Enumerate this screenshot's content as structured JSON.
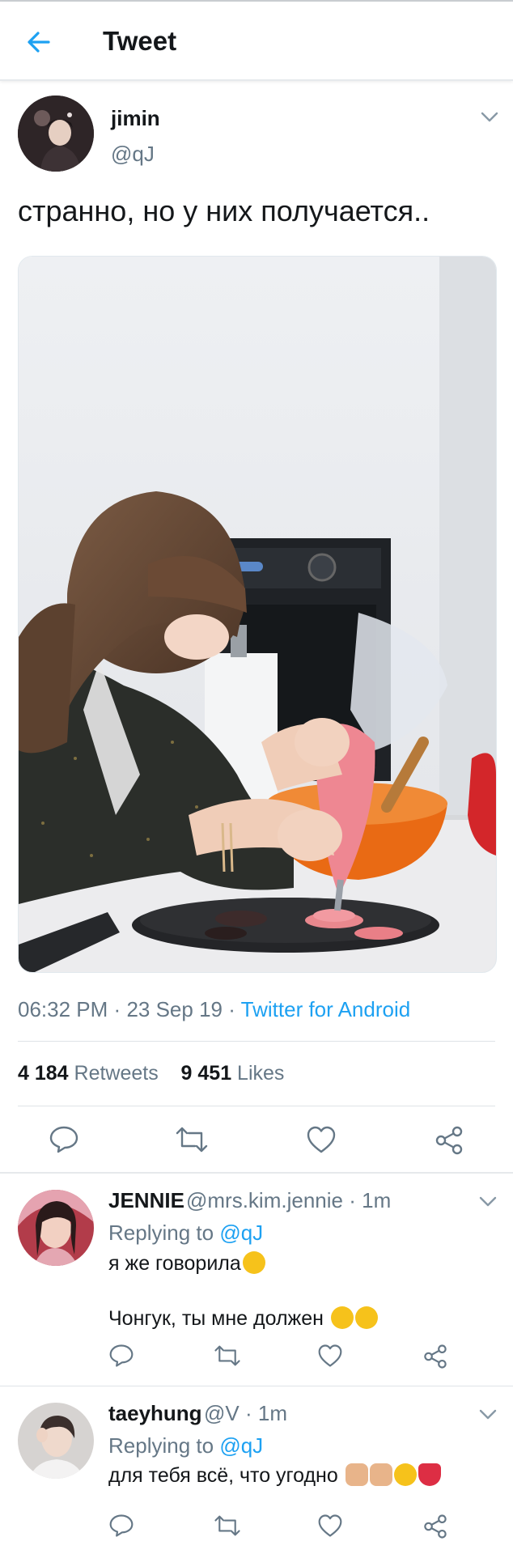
{
  "header": {
    "title": "Tweet"
  },
  "tweet": {
    "name": "jimin",
    "handle": "@qJ",
    "text": "странно, но у них получается..",
    "time": "06:32 PM",
    "date": "23 Sep 19",
    "source": "Twitter for Android",
    "retweets_count": "4 184",
    "retweets_label": "Retweets",
    "likes_count": "9 451",
    "likes_label": "Likes",
    "sep": "·"
  },
  "icons": [
    "back-arrow-icon",
    "chevron-down-icon",
    "reply-icon",
    "retweet-icon",
    "like-icon",
    "share-icon"
  ],
  "colors": {
    "accent": "#1da1f2",
    "secondary_text": "#657786",
    "primary_text": "#14171a"
  },
  "replies": [
    {
      "name": "JENNIE",
      "handle": "@mrs.kim.jennie",
      "time": "1m",
      "replying_label": "Replying to",
      "replying_to": "@qJ",
      "line1": "я же говорила",
      "line2": "Чонгук, ты мне должен"
    },
    {
      "name": "taeyhung",
      "handle": "@V",
      "time": "1m",
      "replying_label": "Replying to",
      "replying_to": "@qJ",
      "line1": "для тебя всё, что угодно"
    }
  ]
}
